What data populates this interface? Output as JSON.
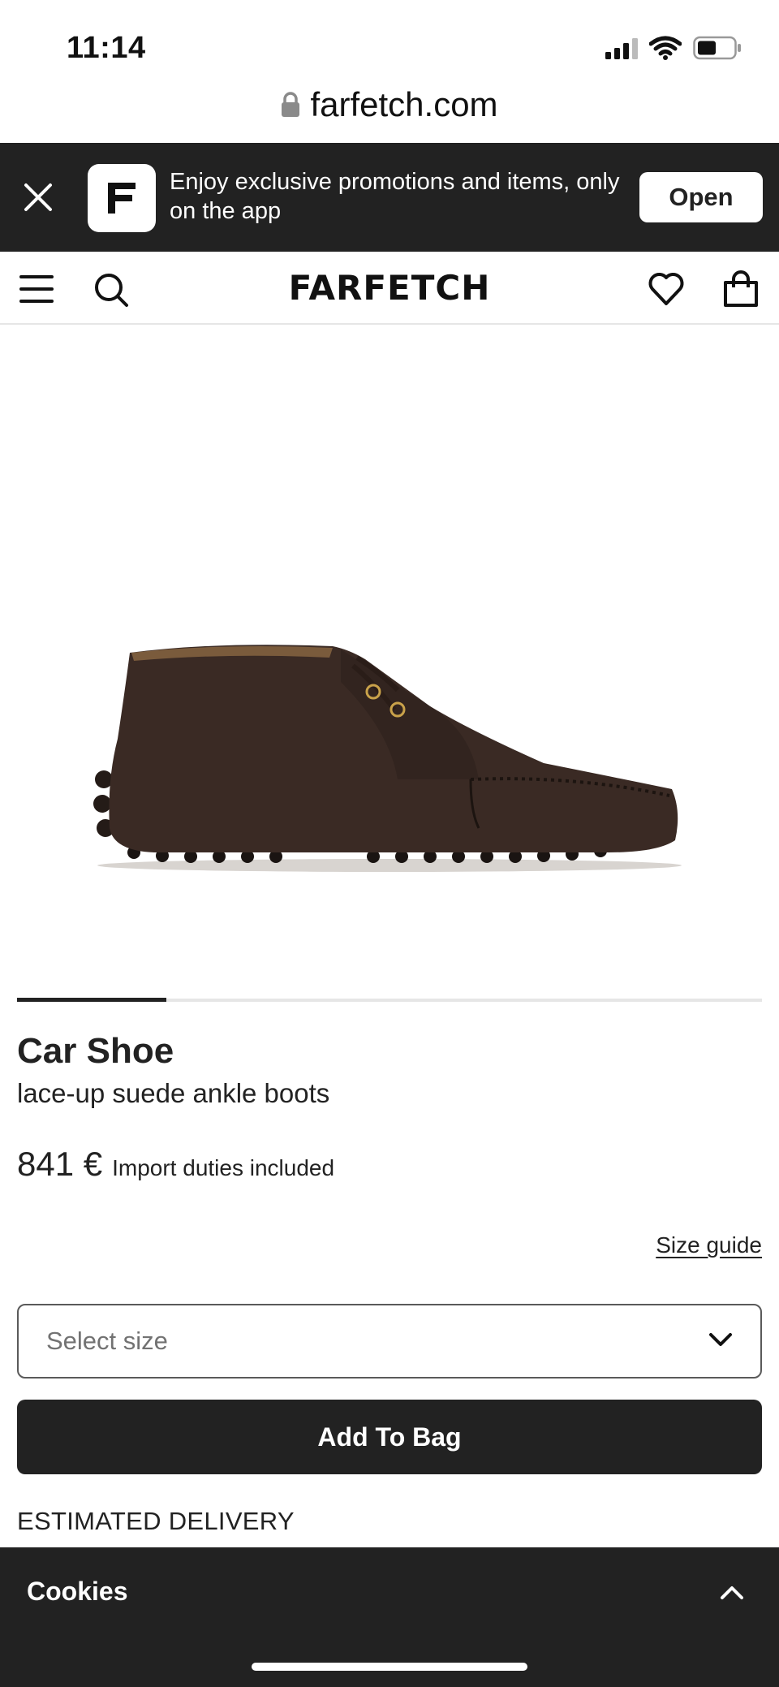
{
  "status_bar": {
    "time": "11:14",
    "icons": [
      "signal-icon",
      "wifi-icon",
      "battery-icon"
    ]
  },
  "browser": {
    "url": "farfetch.com",
    "lock_icon": "lock-icon"
  },
  "app_banner": {
    "close_icon": "close-icon",
    "logo_text": "FF",
    "message": "Enjoy exclusive promotions and items, only on the app",
    "open_label": "Open"
  },
  "nav": {
    "menu_icon": "menu-icon",
    "search_icon": "search-icon",
    "logo": "FARFETCH",
    "wishlist_icon": "heart-icon",
    "bag_icon": "shopping-bag-icon"
  },
  "gallery": {
    "progress": 0.2
  },
  "product": {
    "brand": "Car Shoe",
    "name": "lace-up suede ankle boots",
    "price": "841 €",
    "duties": "Import duties included",
    "size_guide": "Size guide",
    "size_placeholder": "Select size",
    "add_to_bag": "Add To Bag",
    "estimated_delivery": "ESTIMATED DELIVERY"
  },
  "cookies": {
    "label": "Cookies",
    "chevron_icon": "chevron-up-icon"
  },
  "colors": {
    "dark": "#222222",
    "white": "#ffffff",
    "divider": "#e6e6e6",
    "placeholder": "#727272"
  }
}
